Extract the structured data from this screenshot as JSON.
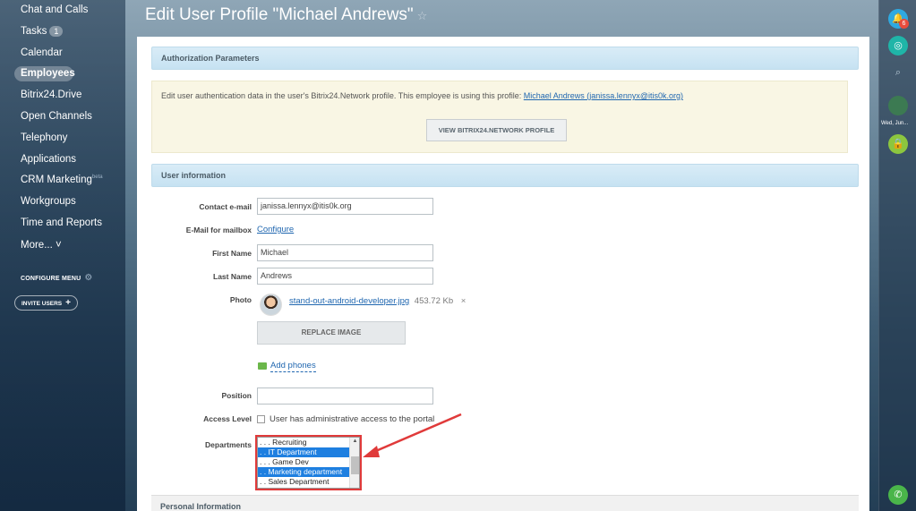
{
  "nav": {
    "items": [
      {
        "label": "Chat and Calls"
      },
      {
        "label": "Tasks",
        "badge": "1"
      },
      {
        "label": "Calendar"
      },
      {
        "label": "Employees"
      },
      {
        "label": "Bitrix24.Drive"
      },
      {
        "label": "Open Channels"
      },
      {
        "label": "Telephony"
      },
      {
        "label": "Applications"
      },
      {
        "label": "CRM Marketing",
        "badge": "beta"
      },
      {
        "label": "Workgroups"
      },
      {
        "label": "Time and Reports"
      },
      {
        "label": "More... ˅"
      }
    ],
    "configure_menu": "CONFIGURE MENU",
    "invite_users": "INVITE USERS"
  },
  "header": {
    "title": "Edit User Profile \"Michael Andrews\""
  },
  "right_panel": {
    "notifications_count": "6",
    "date": "Wed, Jun..."
  },
  "auth": {
    "header": "Authorization Parameters",
    "text": "Edit user authentication data in the user's Bitrix24.Network profile. This employee is using this profile: ",
    "profile_link": "Michael Andrews (janissa.lennyx@itis0k.org)",
    "button": "VIEW BITRIX24.NETWORK PROFILE"
  },
  "user_info": {
    "header": "User information",
    "contact_email_label": "Contact e-mail",
    "contact_email": "janissa.lennyx@itis0k.org",
    "mailbox_label": "E-Mail for mailbox",
    "mailbox_link": "Configure",
    "first_name_label": "First Name",
    "first_name": "Michael",
    "last_name_label": "Last Name",
    "last_name": "Andrews",
    "photo_label": "Photo",
    "photo_file": "stand-out-android-developer.jpg",
    "photo_size": "453.72 Kb",
    "photo_remove": "×",
    "replace_button": "REPLACE IMAGE",
    "add_phones": "Add phones",
    "position_label": "Position",
    "position": "",
    "access_label": "Access Level",
    "access_checkbox": "User has administrative access to the portal",
    "departments_label": "Departments",
    "departments": [
      {
        "label": ". . . Recruiting",
        "selected": false
      },
      {
        "label": ". . IT Department",
        "selected": true
      },
      {
        "label": ". . . Game Dev",
        "selected": false
      },
      {
        "label": ". . Marketing department",
        "selected": true
      },
      {
        "label": ". . Sales Department",
        "selected": false
      }
    ]
  },
  "personal": {
    "header": "Personal Information"
  },
  "colors": {
    "accent": "#1e7fe0",
    "highlight": "#e03a3a",
    "link": "#2067b0"
  }
}
